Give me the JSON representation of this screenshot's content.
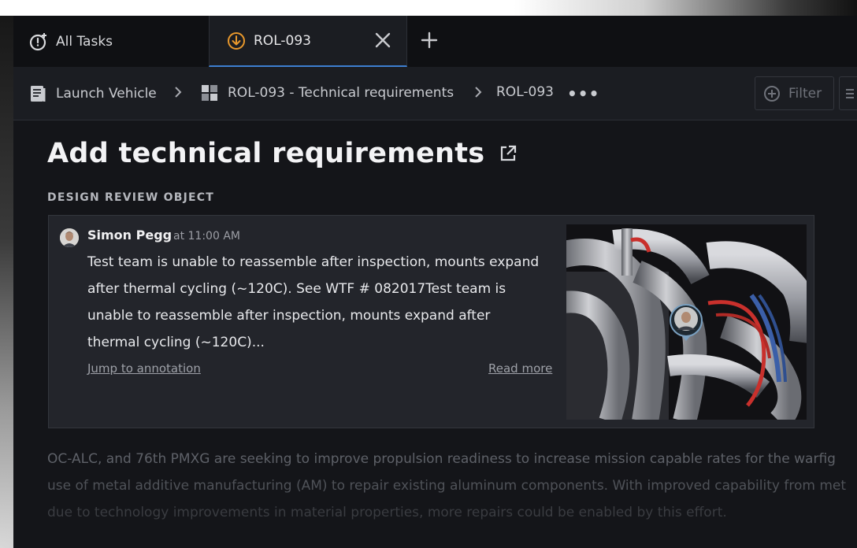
{
  "tabs": {
    "all_tasks": "All Tasks",
    "active": "ROL-093",
    "close_icon": "close-icon",
    "add_icon": "plus-icon"
  },
  "breadcrumb": {
    "items": [
      "Launch Vehicle",
      "ROL-093 - Technical requirements",
      "ROL-093"
    ],
    "more": "•••"
  },
  "toolbar": {
    "filter_label": "Filter"
  },
  "page": {
    "title": "Add technical requirements",
    "section_label": "DESIGN REVIEW OBJECT"
  },
  "comment": {
    "author": "Simon Pegg",
    "time": "at 11:00 AM",
    "lines": [
      "Test team is unable to reassemble after inspection, mounts expand",
      "after thermal cycling (~120C). See WTF # 082017Test team is",
      "unable to reassemble after inspection, mounts expand after",
      "thermal cycling (~120C)..."
    ],
    "jump_link": "Jump to annotation",
    "read_more": "Read more"
  },
  "description": {
    "lines": [
      "OC-ALC, and 76th PMXG are seeking to improve propulsion readiness to increase mission capable rates for the warfig",
      "use of metal additive manufacturing (AM) to repair existing aluminum components. With improved capability from met",
      "due to technology improvements in material properties, more repairs could be enabled by this effort."
    ]
  },
  "colors": {
    "accent_blue": "#3d7fd1",
    "accent_orange": "#e8982c",
    "background": "#141519"
  }
}
